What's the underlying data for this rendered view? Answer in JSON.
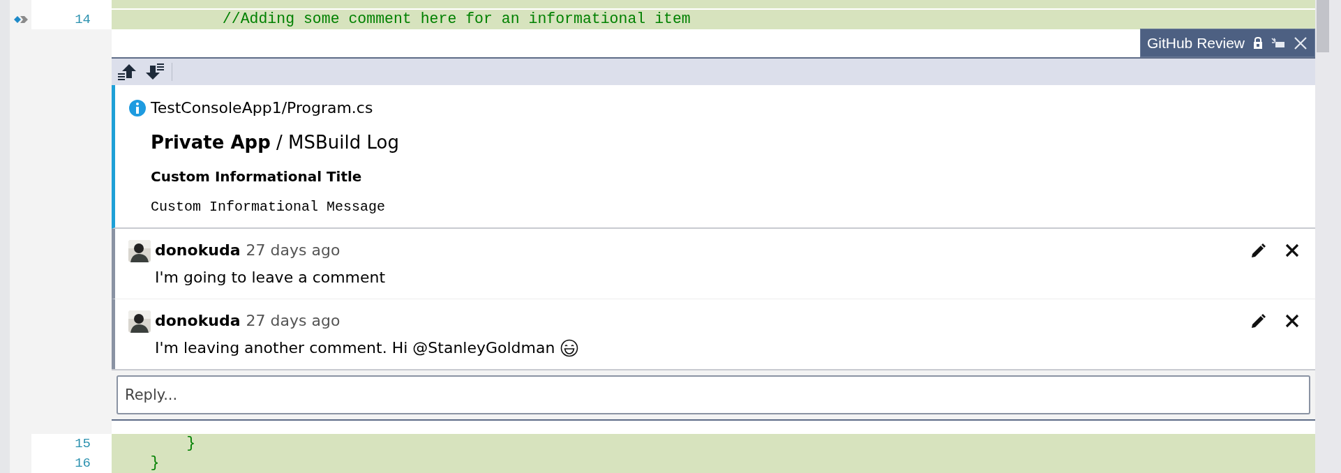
{
  "editor": {
    "lines_before": [
      {
        "number": "14",
        "code": "            //Adding some comment here for an informational item",
        "marker": true
      }
    ],
    "lines_after": [
      {
        "number": "15",
        "code": "        }",
        "marker": false
      },
      {
        "number": "16",
        "code": "    }",
        "marker": false
      }
    ]
  },
  "panel": {
    "tab": {
      "title": "GitHub Review"
    },
    "toolbar": [
      {
        "kind": "previous"
      },
      {
        "kind": "next"
      }
    ],
    "annotation": {
      "file": "TestConsoleApp1/Program.cs",
      "source": "**Private App** / MSBuild Log",
      "title": "Custom Informational Title",
      "message": "Custom Informational Message"
    },
    "comments": [
      {
        "author": "donokuda",
        "time": "27 days ago",
        "body": "I'm going to leave a comment",
        "emoji": false
      },
      {
        "author": "donokuda",
        "time": "27 days ago",
        "body": "I'm leaving another comment. Hi @StanleyGoldman",
        "emoji": true
      }
    ],
    "reply": {
      "placeholder": "Reply..."
    }
  }
}
